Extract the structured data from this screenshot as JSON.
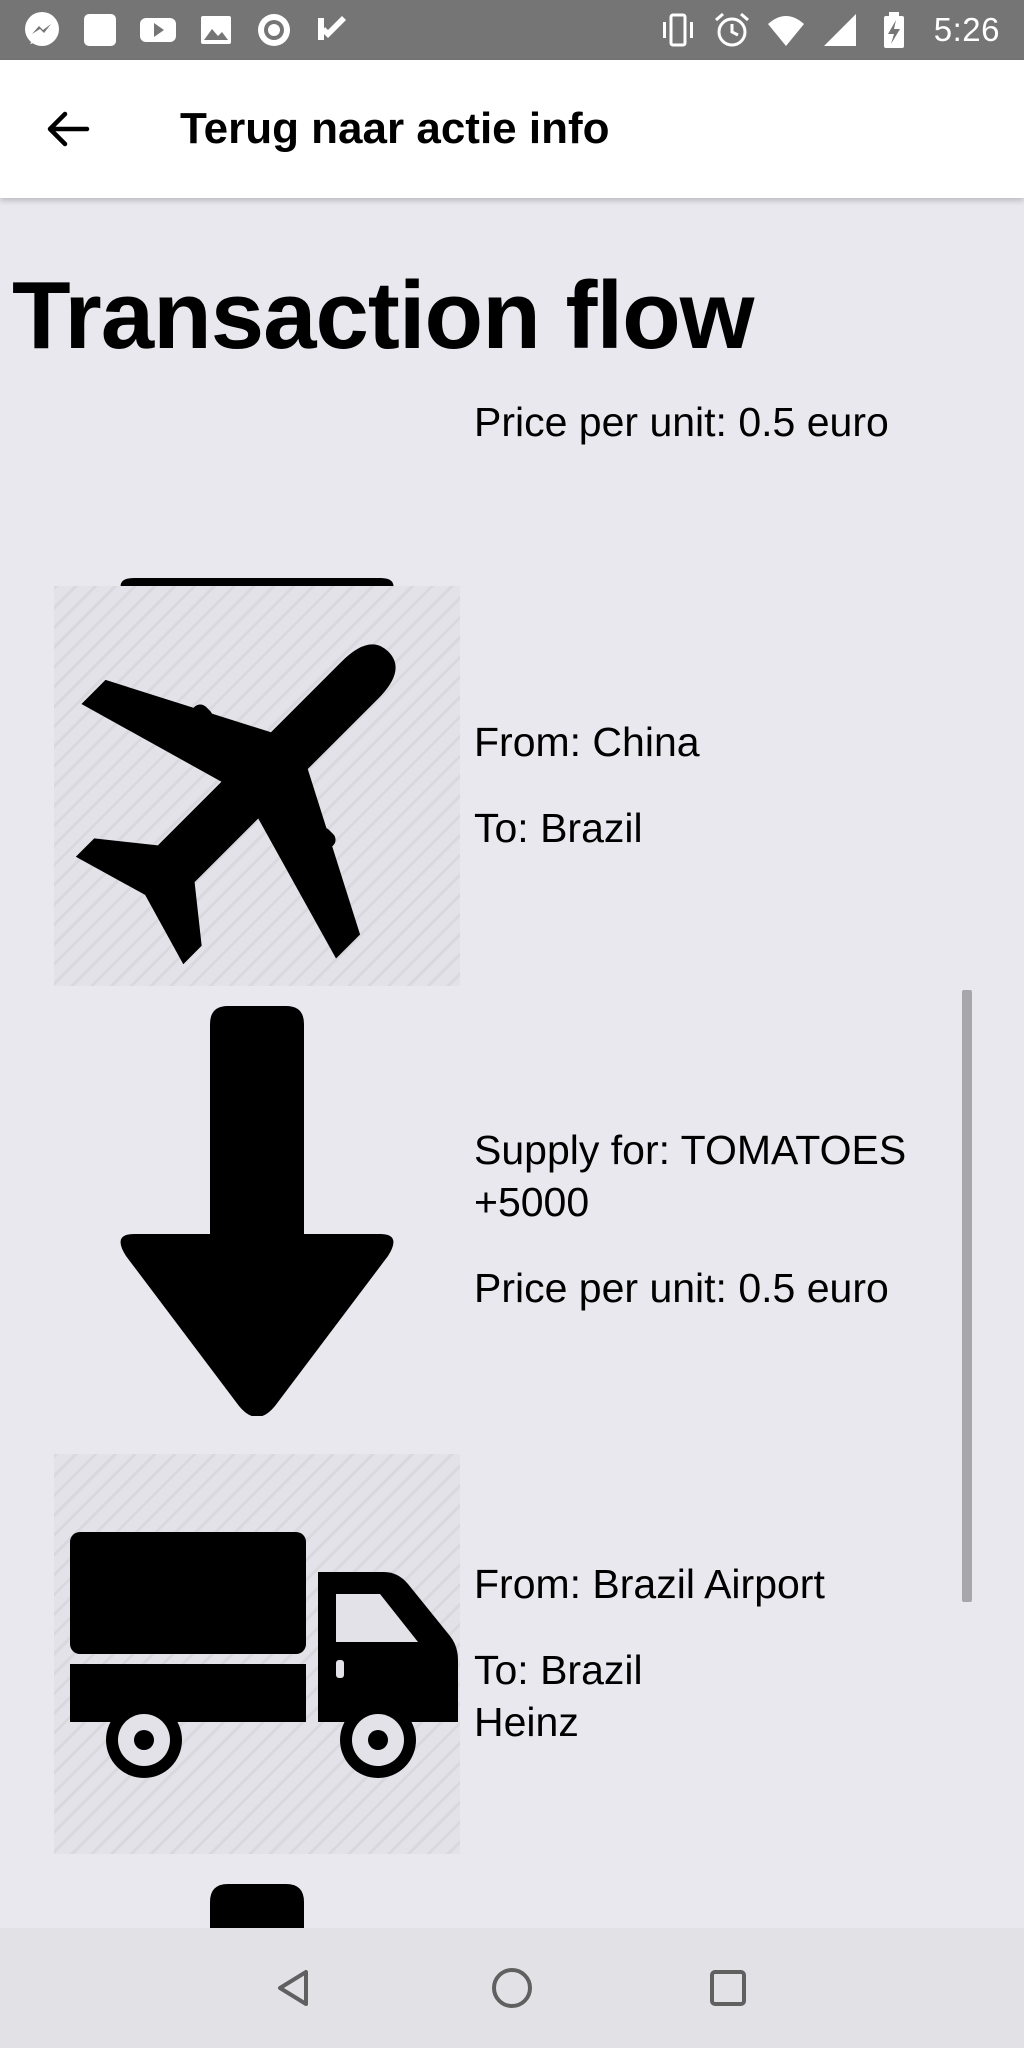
{
  "status_bar": {
    "time": "5:26",
    "left_icons": [
      "messenger-icon",
      "square-notification-icon",
      "youtube-icon",
      "image-icon",
      "circle-record-icon",
      "checkmark-icon"
    ],
    "right_icons": [
      "vibrate-icon",
      "alarm-icon",
      "wifi-icon",
      "signal-icon",
      "battery-charging-icon"
    ]
  },
  "app_bar": {
    "back_icon": "arrow-left-icon",
    "title": "Terug naar actie info"
  },
  "page": {
    "title": "Transaction flow"
  },
  "steps": [
    {
      "icon": "arrow-down-icon",
      "lines": [
        "Price per unit: 0.5 euro"
      ]
    },
    {
      "icon": "airplane-icon",
      "lines": [
        "From: China",
        "To: Brazil"
      ]
    },
    {
      "icon": "arrow-down-icon",
      "lines": [
        "Supply for: TOMATOES\n+5000",
        "Price per unit: 0.5 euro"
      ]
    },
    {
      "icon": "truck-icon",
      "lines": [
        "From: Brazil Airport",
        "To: Brazil\nHeinz"
      ]
    },
    {
      "icon": "arrow-down-icon",
      "lines": []
    }
  ],
  "nav_bar": {
    "buttons": [
      "back-triangle-icon",
      "home-circle-icon",
      "recents-square-icon"
    ]
  },
  "colors": {
    "status_bar_bg": "#757575",
    "app_bar_bg": "#ffffff",
    "content_bg": "#e9e8ee",
    "nav_bar_bg": "#e2e1e6",
    "icon_color": "#000000"
  }
}
